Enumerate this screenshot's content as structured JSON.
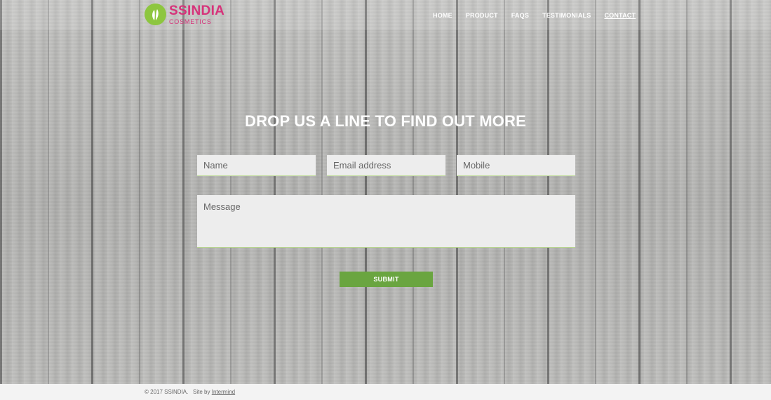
{
  "brand": {
    "name": "SSINDIA",
    "subtitle": "COSMETICS",
    "color": "#d6337a",
    "mark_color": "#8dc63f",
    "icon": "leaf-icon"
  },
  "nav": {
    "items": [
      {
        "label": "HOME"
      },
      {
        "label": "PRODUCT"
      },
      {
        "label": "FAQS"
      },
      {
        "label": "TESTIMONIALS"
      },
      {
        "label": "CONTACT",
        "active": true
      }
    ]
  },
  "contact": {
    "title": "DROP US A LINE TO FIND OUT MORE",
    "fields": {
      "name": {
        "placeholder": "Name",
        "value": ""
      },
      "email": {
        "placeholder": "Email address",
        "value": ""
      },
      "mobile": {
        "placeholder": "Mobile",
        "value": ""
      },
      "message": {
        "placeholder": "Message",
        "value": ""
      }
    },
    "submit_label": "SUBMIT",
    "submit_color": "#6aa540"
  },
  "footer": {
    "copyright": "© 2017 SSINDIA.",
    "site_by": "Site by",
    "site_by_link": "Intermind"
  }
}
